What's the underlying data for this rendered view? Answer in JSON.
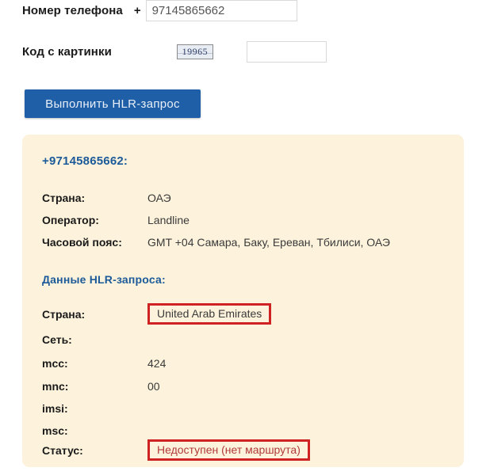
{
  "form": {
    "phone": {
      "label": "Номер телефона",
      "plus": "+",
      "value": "97145865662",
      "placeholder": ""
    },
    "captcha": {
      "label": "Код с картинки",
      "image_text": "19965",
      "value": "",
      "placeholder": ""
    },
    "submit_label": "Выполнить HLR-запрос"
  },
  "result": {
    "title": "+97145865662:",
    "basic_rows": [
      {
        "key": "Страна:",
        "value": "ОАЭ"
      },
      {
        "key": "Оператор:",
        "value": "Landline"
      },
      {
        "key": "Часовой пояс:",
        "value": "GMT +04 Самара, Баку, Ереван, Тбилиси, ОАЭ"
      }
    ],
    "hlr_section_title": "Данные HLR-запроса:",
    "hlr_rows": [
      {
        "key": "Страна:",
        "value": "United Arab Emirates"
      },
      {
        "key": "Сеть:",
        "value": ""
      },
      {
        "key": "mcc:",
        "value": "424"
      },
      {
        "key": "mnc:",
        "value": "00"
      },
      {
        "key": "imsi:",
        "value": ""
      },
      {
        "key": "msc:",
        "value": ""
      },
      {
        "key": "Статус:",
        "value": "Недоступен (нет маршрута)"
      }
    ]
  },
  "colors": {
    "panel_background": "#FDF3DC",
    "heading_blue": "#1C5A99",
    "button_blue": "#1F5FA8",
    "highlight_red": "#CF2323",
    "status_red": "#B13A3A"
  }
}
